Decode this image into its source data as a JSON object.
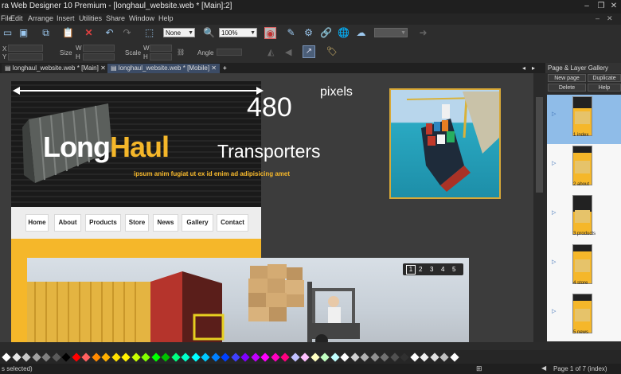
{
  "window": {
    "title": "ra Web Designer 10 Premium - [longhaul_website.web * [Main]:2]"
  },
  "menu": [
    "File",
    "Edit",
    "Arrange",
    "Insert",
    "Utilities",
    "Share",
    "Window",
    "Help"
  ],
  "toolbar": {
    "fill_value": "None",
    "zoom_value": "100%",
    "labels": {
      "x": "X",
      "y": "Y",
      "w": "W",
      "h": "H",
      "size": "Size",
      "scale": "Scale",
      "angle": "Angle"
    }
  },
  "tabs": [
    {
      "label": "longhaul_website.web * [Main]"
    },
    {
      "label": "longhaul_website.web * [Mobile]"
    }
  ],
  "tab_add": "+",
  "canvas": {
    "width_label_value": "480",
    "width_label_unit": "pixels",
    "logo_part1": "Long",
    "logo_part2": "Haul",
    "logo_tagline": "Transporters",
    "lorem": "ipsum anim fugiat ut ex id enim ad adipisicing amet",
    "nav": [
      "Home",
      "About",
      "Products",
      "Store",
      "News",
      "Gallery",
      "Contact"
    ],
    "slider_pages": [
      "1",
      "2",
      "3",
      "4",
      "5"
    ]
  },
  "panel": {
    "title": "Page & Layer Gallery",
    "buttons": [
      "New page",
      "Duplicate",
      "Delete",
      "Help"
    ],
    "pages": [
      "1 index",
      "2 about",
      "3 products",
      "4 store",
      "5 news"
    ]
  },
  "status": {
    "left": "s selected)",
    "page_info": "Page 1 of 7 (index)"
  },
  "colors": {
    "accent": "#f5b72a",
    "swatches": [
      "#ffffff",
      "#e6e6e6",
      "#c8c8c8",
      "#a0a0a0",
      "#808080",
      "#5a5a5a",
      "#000000",
      "#ff0000",
      "#ff6060",
      "#ff8a00",
      "#ffb000",
      "#ffe000",
      "#fff200",
      "#c8ff00",
      "#80ff00",
      "#00ff00",
      "#00c000",
      "#00ff80",
      "#00ffc8",
      "#00ffff",
      "#00c8ff",
      "#0080ff",
      "#0040ff",
      "#4040ff",
      "#8000ff",
      "#c000ff",
      "#ff00ff",
      "#ff00c0",
      "#ff0080",
      "#c0c0ff",
      "#ffc0ff",
      "#ffffc0",
      "#c0ffc0",
      "#c0ffff",
      "#ffffff",
      "#d0d0d0",
      "#b0b0b0",
      "#909090",
      "#707070",
      "#505050",
      "#303030",
      "#ffffff",
      "#f0f0f0",
      "#e0e0e0",
      "#c0c0c0",
      "#ffffff"
    ]
  }
}
